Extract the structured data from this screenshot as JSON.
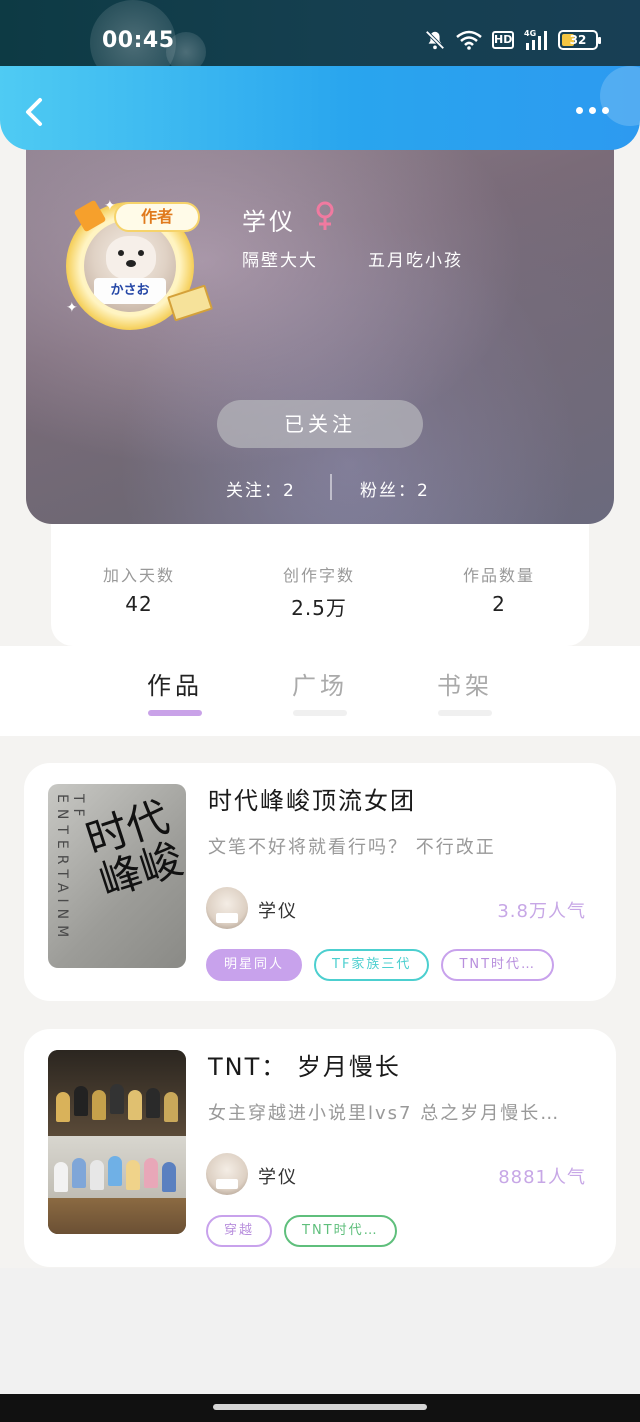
{
  "status_bar": {
    "time": "00:45",
    "hd": "HD",
    "network": "4G",
    "battery": "32"
  },
  "header": {
    "back_icon": "chevron-left-icon",
    "more_icon": "more-horizontal-icon"
  },
  "profile": {
    "author_badge": "作者",
    "avatar_sign": "かさお",
    "username": "学仪",
    "gender": "female",
    "tags": [
      "隔壁大大",
      "五月吃小孩"
    ],
    "follow_button": "已关注",
    "following": "关注：2",
    "fans": "粉丝：2"
  },
  "stats": [
    {
      "label": "加入天数",
      "value": "42"
    },
    {
      "label": "创作字数",
      "value": "2.5万"
    },
    {
      "label": "作品数量",
      "value": "2"
    }
  ],
  "tabs": [
    {
      "label": "作品",
      "active": true
    },
    {
      "label": "广场",
      "active": false
    },
    {
      "label": "书架",
      "active": false
    }
  ],
  "works": [
    {
      "title": "时代峰峻顶流女团",
      "desc": "文笔不好将就看行吗？    不行改正",
      "cover_text": "TF ENTERTAINM",
      "cover_callig": "时代峰峻",
      "author": "学仪",
      "popularity": "3.8万人气",
      "tags": [
        {
          "label": "明星同人",
          "style": "purple-fill"
        },
        {
          "label": "TF家族三代",
          "style": "teal"
        },
        {
          "label": "TNT时代…",
          "style": "purple"
        }
      ]
    },
    {
      "title": "TNT：  岁月慢长",
      "desc": "女主穿越进小说里lvs7    总之岁月慢长…",
      "author": "学仪",
      "popularity": "8881人气",
      "tags": [
        {
          "label": "穿越",
          "style": "purple"
        },
        {
          "label": "TNT时代…",
          "style": "green"
        }
      ]
    }
  ],
  "colors": {
    "header_gradient_start": "#4fcbf3",
    "header_gradient_end": "#2d9af0",
    "accent_purple": "#c8a2ec",
    "teal": "#4ccfcf",
    "green": "#5fbf7c",
    "female_pink": "#f07aa0"
  }
}
